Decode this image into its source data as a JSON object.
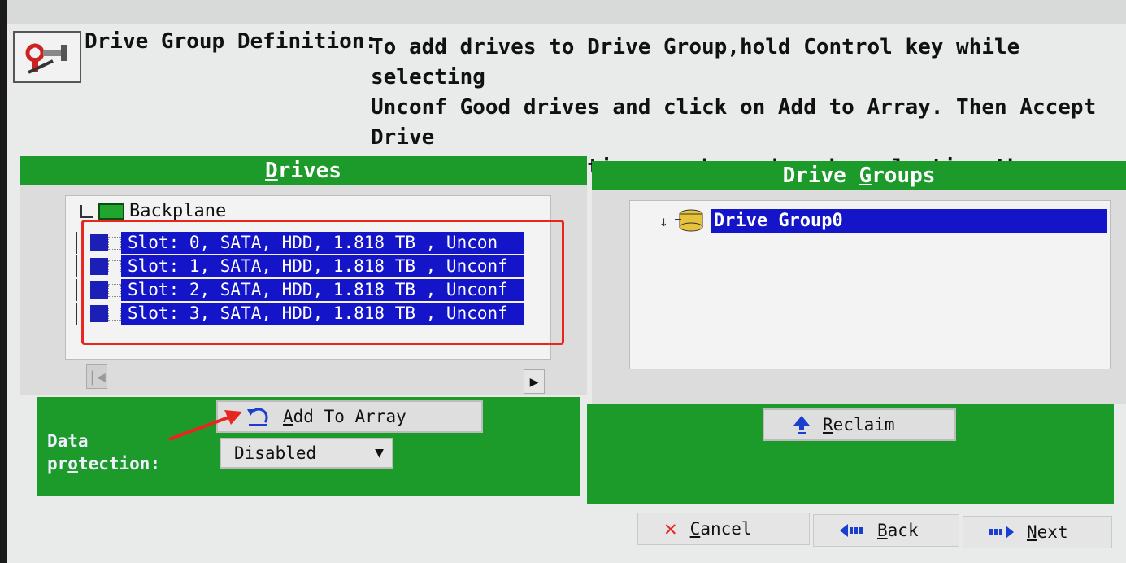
{
  "header": {
    "title": "Drive Group Definition:",
    "instructions": "To add drives to Drive Group,hold Control key while selecting\nUnconf Good drives and click on Add to Array. Then Accept Drive\nGroup. Drive addition can be undone by selecting the Reclaim\nbutton."
  },
  "drives_panel": {
    "header_prefix": "",
    "header_underlined": "D",
    "header_rest": "rives",
    "root_label": "Backplane",
    "slots": [
      {
        "label": "Slot: 0, SATA, HDD, 1.818 TB , Uncon"
      },
      {
        "label": "Slot: 1, SATA, HDD, 1.818 TB , Unconf"
      },
      {
        "label": "Slot: 2, SATA, HDD, 1.818 TB , Unconf"
      },
      {
        "label": "Slot: 3, SATA, HDD, 1.818 TB , Unconf"
      }
    ]
  },
  "groups_panel": {
    "header_prefix": "Drive ",
    "header_underlined": "G",
    "header_rest": "roups",
    "items": [
      {
        "label": "Drive Group0"
      }
    ]
  },
  "actions": {
    "add_to_array_underlined": "A",
    "add_to_array_rest": "dd To Array",
    "data_protection_line1": "Data",
    "data_protection_line2_pre": "pr",
    "data_protection_line2_u": "o",
    "data_protection_line2_post": "tection:",
    "data_protection_value": "Disabled",
    "reclaim_underlined": "R",
    "reclaim_rest": "eclaim"
  },
  "nav": {
    "cancel_underlined": "C",
    "cancel_rest": "ancel",
    "back_underlined": "B",
    "back_rest": "ack",
    "next_underlined": "N",
    "next_rest": "ext"
  },
  "colors": {
    "panel_green": "#1c9a2a",
    "selection_blue": "#1414c8",
    "annotation_red": "#e8261f"
  }
}
